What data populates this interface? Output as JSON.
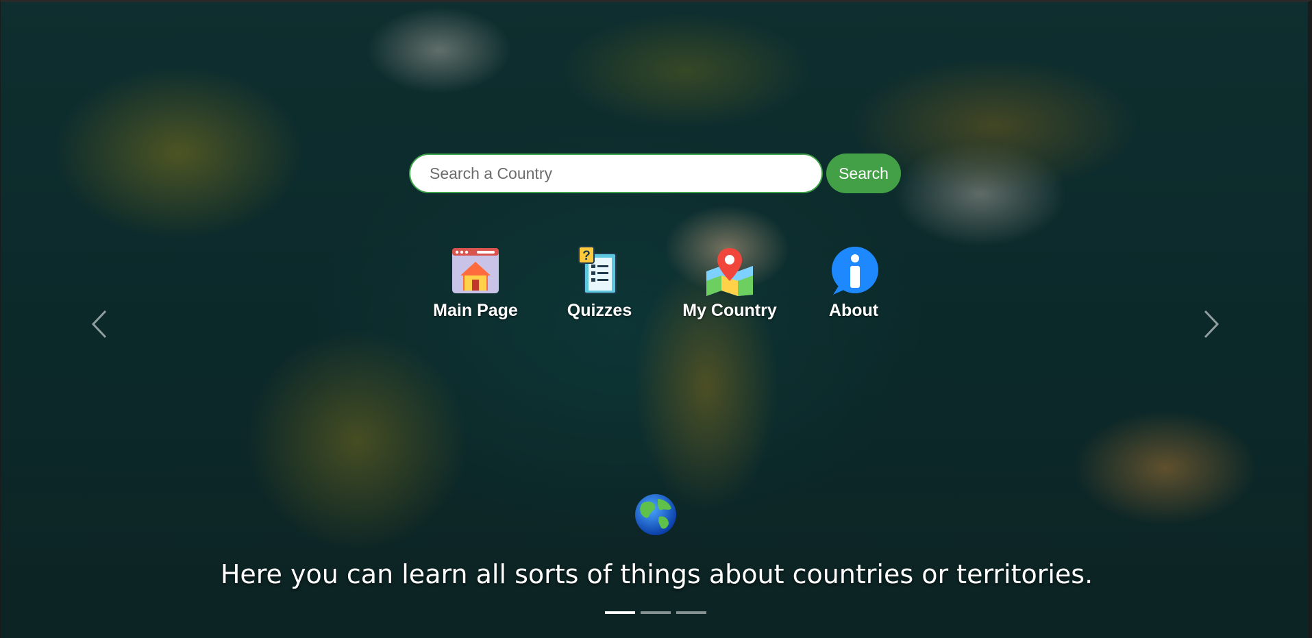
{
  "search": {
    "placeholder": "Search a Country",
    "button_label": "Search"
  },
  "nav": {
    "items": [
      {
        "label": "Main Page",
        "icon": "house-window-icon"
      },
      {
        "label": "Quizzes",
        "icon": "quiz-document-icon"
      },
      {
        "label": "My Country",
        "icon": "map-pin-icon"
      },
      {
        "label": "About",
        "icon": "info-bubble-icon"
      }
    ]
  },
  "carousel": {
    "caption": "Here you can learn all sorts of things about countries or territories.",
    "slide_icon": "globe-icon",
    "slide_count": 3,
    "active_slide": 1,
    "prev_icon": "chevron-left-icon",
    "next_icon": "chevron-right-icon"
  },
  "colors": {
    "accent": "#43a047",
    "search_border": "#3fa34a"
  }
}
